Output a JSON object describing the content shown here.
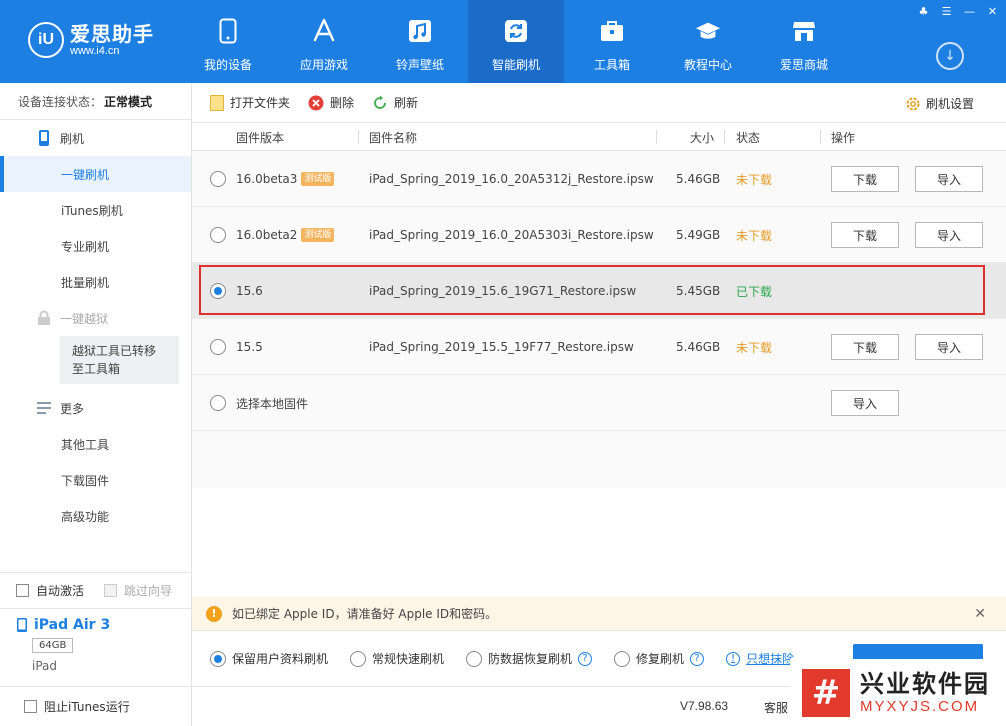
{
  "brand": {
    "name": "爱思助手",
    "url": "www.i4.cn",
    "logo_text": "iU"
  },
  "nav": [
    {
      "label": "我的设备",
      "icon": "phone-icon"
    },
    {
      "label": "应用游戏",
      "icon": "app-store-icon"
    },
    {
      "label": "铃声壁纸",
      "icon": "music-icon"
    },
    {
      "label": "智能刷机",
      "icon": "refresh-icon",
      "active": true
    },
    {
      "label": "工具箱",
      "icon": "toolbox-icon"
    },
    {
      "label": "教程中心",
      "icon": "graduation-cap-icon"
    },
    {
      "label": "爱思商城",
      "icon": "shop-icon"
    }
  ],
  "window_controls": {
    "skin": "♣",
    "menu": "☰",
    "minimize": "—",
    "close": "✕"
  },
  "sidebar": {
    "status_label": "设备连接状态：",
    "status_value": "正常模式",
    "flash_section": "刷机",
    "items": [
      "一键刷机",
      "iTunes刷机",
      "专业刷机",
      "批量刷机"
    ],
    "jailbreak_section": "一键越狱",
    "jailbreak_note": "越狱工具已转移至工具箱",
    "more_section": "更多",
    "more_items": [
      "其他工具",
      "下载固件",
      "高级功能"
    ],
    "auto_activate": "自动激活",
    "skip_guide": "跳过向导",
    "device_name": "iPad Air 3",
    "device_capacity": "64GB",
    "device_type": "iPad",
    "block_itunes": "阻止iTunes运行"
  },
  "toolbar": {
    "open_folder": "打开文件夹",
    "delete": "删除",
    "refresh": "刷新",
    "settings": "刷机设置"
  },
  "table": {
    "headers": {
      "version": "固件版本",
      "name": "固件名称",
      "size": "大小",
      "status": "状态",
      "action": "操作"
    },
    "rows": [
      {
        "version": "16.0beta3",
        "badge": "测试版",
        "name": "iPad_Spring_2019_16.0_20A5312j_Restore.ipsw",
        "size": "5.46GB",
        "status": "未下载",
        "download": "下载",
        "import": "导入",
        "selected": false
      },
      {
        "version": "16.0beta2",
        "badge": "测试版",
        "name": "iPad_Spring_2019_16.0_20A5303i_Restore.ipsw",
        "size": "5.49GB",
        "status": "未下载",
        "download": "下载",
        "import": "导入",
        "selected": false
      },
      {
        "version": "15.6",
        "badge": "",
        "name": "iPad_Spring_2019_15.6_19G71_Restore.ipsw",
        "size": "5.45GB",
        "status": "已下载",
        "download": "",
        "import": "",
        "selected": true
      },
      {
        "version": "15.5",
        "badge": "",
        "name": "iPad_Spring_2019_15.5_19F77_Restore.ipsw",
        "size": "5.46GB",
        "status": "未下载",
        "download": "下载",
        "import": "导入",
        "selected": false
      }
    ],
    "local_label": "选择本地固件",
    "local_import": "导入"
  },
  "notice": {
    "text": "如已绑定 Apple ID，请准备好 Apple ID和密码。",
    "close": "✕"
  },
  "modes": {
    "keep_data": "保留用户资料刷机",
    "quick": "常规快速刷机",
    "anti_recovery": "防数据恢复刷机",
    "repair": "修复刷机",
    "erase_link": "只想抹除"
  },
  "footer": {
    "version": "V7.98.63",
    "feedback": "客服"
  },
  "watermark": {
    "mark": "#",
    "cn": "兴业软件园",
    "en": "MYXYJS.COM"
  },
  "colors": {
    "primary": "#1e7fe3",
    "not_downloaded": "#e89a24",
    "downloaded": "#2aa84a",
    "highlight_border": "#e0302d"
  }
}
